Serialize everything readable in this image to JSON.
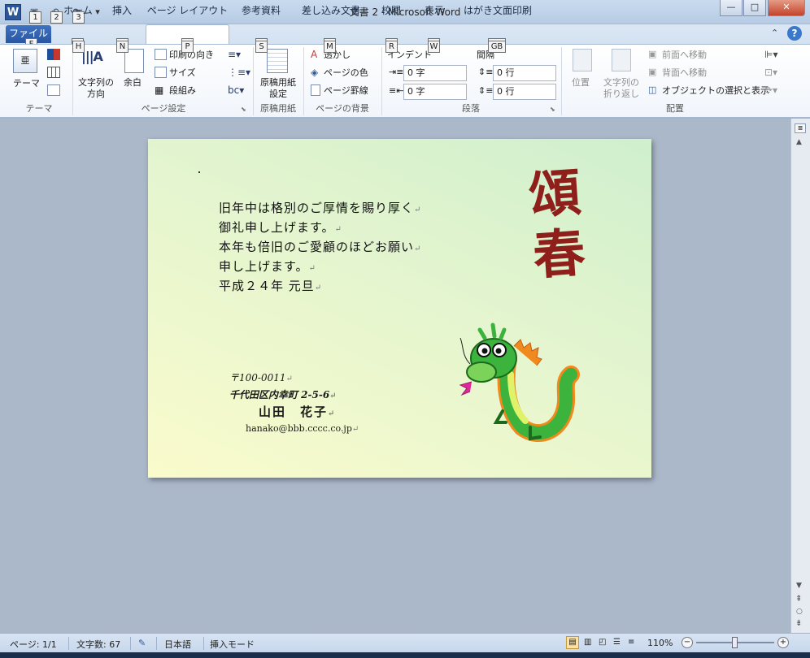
{
  "window": {
    "title": "文書 2 - Microsoft Word",
    "minimize": "—",
    "maximize": "□",
    "close": "✕"
  },
  "qat": {
    "keytips": [
      "1",
      "2",
      "3"
    ]
  },
  "tabs": [
    {
      "label": "ファイル",
      "keytip": "F"
    },
    {
      "label": "ホーム",
      "keytip": "H"
    },
    {
      "label": "挿入",
      "keytip": "N"
    },
    {
      "label": "ページ レイアウト",
      "keytip": "P"
    },
    {
      "label": "参考資料",
      "keytip": "S"
    },
    {
      "label": "差し込み文書",
      "keytip": "M"
    },
    {
      "label": "校閲",
      "keytip": "R"
    },
    {
      "label": "表示",
      "keytip": "W"
    },
    {
      "label": "はがき文面印刷",
      "keytip": "GB"
    }
  ],
  "ribbon": {
    "theme": {
      "theme_label": "テーマ",
      "group": "テーマ"
    },
    "page_setup": {
      "text_direction": "文字列の\n方向",
      "margins": "余白",
      "orientation": "印刷の向き",
      "size": "サイズ",
      "columns": "段組み",
      "group": "ページ設定"
    },
    "manuscript": {
      "label": "原稿用紙\n設定",
      "group": "原稿用紙"
    },
    "background": {
      "watermark": "透かし",
      "page_color": "ページの色",
      "page_border": "ページ罫線",
      "group": "ページの背景"
    },
    "paragraph": {
      "indent_label": "インデント",
      "spacing_label": "間隔",
      "indent_left": "0 字",
      "indent_right": "0 字",
      "space_before": "0 行",
      "space_after": "0 行",
      "group": "段落"
    },
    "arrange": {
      "position": "位置",
      "wrap": "文字列の\n折り返し",
      "bring_forward": "前面へ移動",
      "send_backward": "背面へ移動",
      "selection_pane": "オブジェクトの選択と表示",
      "group": "配置"
    }
  },
  "document": {
    "greeting": [
      "旧年中は格別のご厚情を賜り厚く",
      "御礼申し上げます。",
      "本年も倍旧のご愛顧のほどお願い",
      "申し上げます。",
      "平成２４年 元旦"
    ],
    "zip": "〒100-0011",
    "address": "千代田区内幸町 2-5-6",
    "name": "山田　花子",
    "email": "hanako@bbb.cccc.co.jp",
    "headline": [
      "頌",
      "春"
    ]
  },
  "status": {
    "page": "ページ: 1/1",
    "words": "文字数: 67",
    "language": "日本語",
    "mode": "挿入モード",
    "zoom": "110%"
  },
  "colors": {
    "headline": "#8f1f1a",
    "dragon_green": "#3cb33c",
    "dragon_orange": "#f08a1c",
    "file_tab": "#2b579a"
  }
}
